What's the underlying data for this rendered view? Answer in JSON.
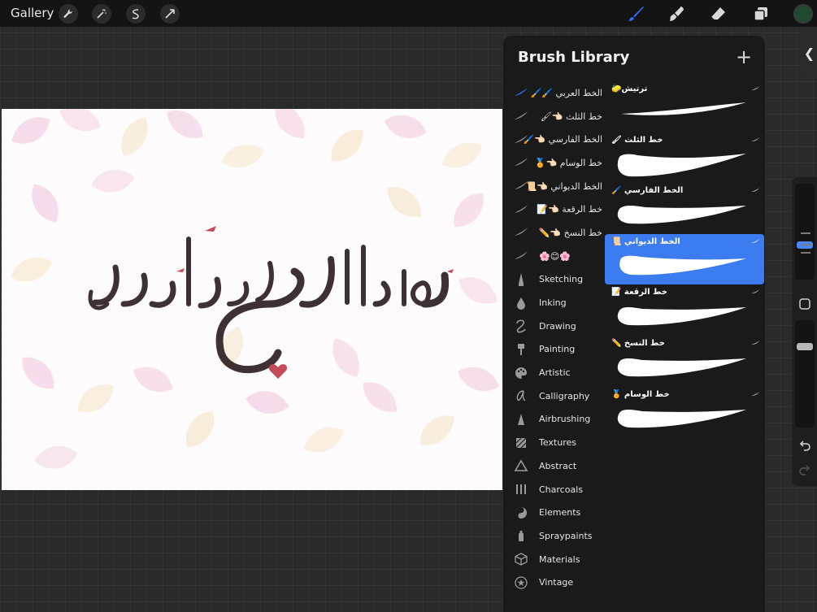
{
  "topbar": {
    "gallery_label": "Gallery",
    "left_tools": [
      "wrench-icon",
      "magic-wand-icon",
      "selection-icon",
      "transform-arrow-icon"
    ],
    "right_tools": [
      "brush-icon",
      "smudge-icon",
      "eraser-icon",
      "layers-icon"
    ],
    "active_tool": "brush-icon",
    "brush_color": "#2f6df2",
    "current_color": "#1d4a30"
  },
  "panel": {
    "title": "Brush Library",
    "add_label": "+",
    "categories": [
      {
        "label": "الخط العربي 🖌️🖌️",
        "icon": "calligraphy-stroke-icon",
        "selected": true,
        "rtl": true
      },
      {
        "label": "خط الثلث 👈🏻🖌",
        "icon": "stroke-icon",
        "rtl": true
      },
      {
        "label": "الخط الفارسي 👈🏻🖌️",
        "icon": "stroke-icon",
        "rtl": true
      },
      {
        "label": "خط الوسام 👈🏻🏅",
        "icon": "stroke-icon",
        "rtl": true
      },
      {
        "label": "الخط الديواني 👈🏻📜",
        "icon": "stroke-icon",
        "rtl": true
      },
      {
        "label": "خط الرقعة 👈🏻📝",
        "icon": "stroke-icon",
        "rtl": true
      },
      {
        "label": "خط النسخ 👈🏻✏️",
        "icon": "stroke-icon",
        "rtl": true
      },
      {
        "label": "🌸😊🌸",
        "icon": "stroke-icon",
        "rtl": true
      },
      {
        "label": "Sketching",
        "icon": "pencil-icon"
      },
      {
        "label": "Inking",
        "icon": "ink-drop-icon"
      },
      {
        "label": "Drawing",
        "icon": "squiggle-icon"
      },
      {
        "label": "Painting",
        "icon": "paint-brush-icon"
      },
      {
        "label": "Artistic",
        "icon": "palette-icon"
      },
      {
        "label": "Calligraphy",
        "icon": "calligraphy-a-icon"
      },
      {
        "label": "Airbrushing",
        "icon": "airbrush-icon"
      },
      {
        "label": "Textures",
        "icon": "texture-icon"
      },
      {
        "label": "Abstract",
        "icon": "triangle-icon"
      },
      {
        "label": "Charcoals",
        "icon": "charcoal-icon"
      },
      {
        "label": "Elements",
        "icon": "yin-yang-icon"
      },
      {
        "label": "Spraypaints",
        "icon": "spray-can-icon"
      },
      {
        "label": "Materials",
        "icon": "cube-icon"
      },
      {
        "label": "Vintage",
        "icon": "star-icon"
      }
    ],
    "brushes": [
      {
        "name": "ترتيش🧽"
      },
      {
        "name": "خط الثلث 🖌"
      },
      {
        "name": "الخط الفارسي 🖌️"
      },
      {
        "name": "الخط الديواني 📜",
        "selected": true
      },
      {
        "name": "خط الرقعة 📝"
      },
      {
        "name": "خط النسخ ✏️"
      },
      {
        "name": "خط الوسام 🏅"
      }
    ]
  },
  "canvas": {
    "artwork_text": "تهادوا الحب غيباً بالدعاء",
    "background_color": "#fdfbfb",
    "ink_color": "#3e3134",
    "accent_color": "#c44a5a"
  },
  "sidebar": {
    "brush_size_level": 0.12,
    "opacity_level": 0.85,
    "icons": [
      "modify-square-icon",
      "undo-icon",
      "redo-icon"
    ]
  }
}
